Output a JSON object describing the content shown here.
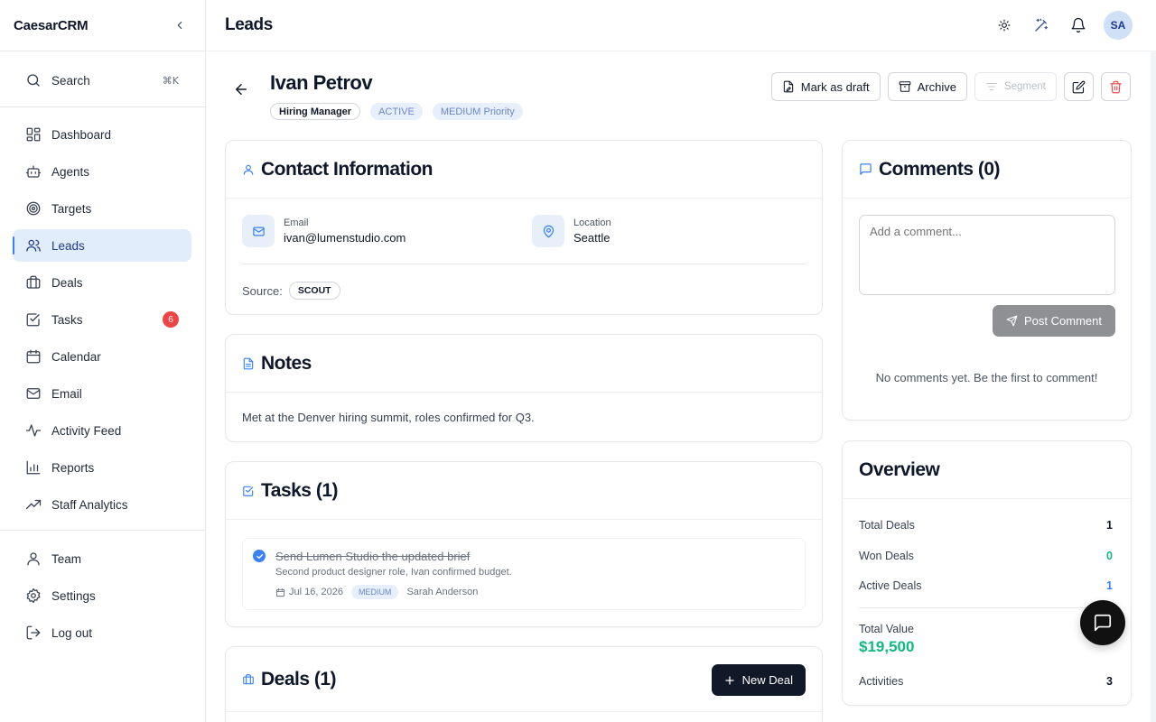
{
  "app": {
    "name": "CaesarCRM"
  },
  "sidebar": {
    "search": {
      "label": "Search",
      "shortcut": "⌘K"
    },
    "items": [
      {
        "label": "Dashboard",
        "icon": "dashboard-icon"
      },
      {
        "label": "Agents",
        "icon": "bot-icon"
      },
      {
        "label": "Targets",
        "icon": "target-icon"
      },
      {
        "label": "Leads",
        "icon": "users-icon",
        "active": true
      },
      {
        "label": "Deals",
        "icon": "briefcase-icon"
      },
      {
        "label": "Tasks",
        "icon": "checkbox-icon",
        "badge": "6"
      },
      {
        "label": "Calendar",
        "icon": "calendar-icon"
      },
      {
        "label": "Email",
        "icon": "mail-icon"
      },
      {
        "label": "Activity Feed",
        "icon": "activity-icon"
      },
      {
        "label": "Reports",
        "icon": "bar-chart-icon"
      },
      {
        "label": "Staff Analytics",
        "icon": "trending-up-icon"
      }
    ],
    "bottom": [
      {
        "label": "Team",
        "icon": "user-icon"
      },
      {
        "label": "Settings",
        "icon": "gear-icon"
      },
      {
        "label": "Log out",
        "icon": "logout-icon"
      }
    ]
  },
  "header": {
    "title": "Leads",
    "avatar": "SA"
  },
  "lead": {
    "name": "Ivan Petrov",
    "tags": {
      "role": "Hiring Manager",
      "status": "ACTIVE",
      "priority": "MEDIUM Priority"
    },
    "actions": {
      "draft": "Mark as draft",
      "archive": "Archive",
      "segment": "Segment"
    }
  },
  "contact": {
    "title": "Contact Information",
    "email_label": "Email",
    "email": "ivan@lumenstudio.com",
    "location_label": "Location",
    "location": "Seattle",
    "source_label": "Source:",
    "source": "SCOUT"
  },
  "notes": {
    "title": "Notes",
    "text": "Met at the Denver hiring summit, roles confirmed for Q3."
  },
  "tasks": {
    "title": "Tasks (1)",
    "items": [
      {
        "title": "Send Lumen Studio the updated brief",
        "description": "Second product designer role, Ivan confirmed budget.",
        "date": "Jul 16, 2026",
        "priority": "MEDIUM",
        "assignee": "Sarah Anderson"
      }
    ]
  },
  "deals": {
    "title": "Deals (1)",
    "new_label": "New Deal"
  },
  "comments": {
    "title": "Comments (0)",
    "placeholder": "Add a comment...",
    "post_label": "Post Comment",
    "empty": "No comments yet. Be the first to comment!"
  },
  "overview": {
    "title": "Overview",
    "total_deals_label": "Total Deals",
    "total_deals": "1",
    "won_deals_label": "Won Deals",
    "won_deals": "0",
    "active_deals_label": "Active Deals",
    "active_deals": "1",
    "total_value_label": "Total Value",
    "total_value": "$19,500",
    "activities_label": "Activities",
    "activities": "3"
  },
  "colors": {
    "accent": "#3b82f6",
    "active_bg": "#e2edfb",
    "success": "#10b981",
    "danger": "#ef4444"
  }
}
